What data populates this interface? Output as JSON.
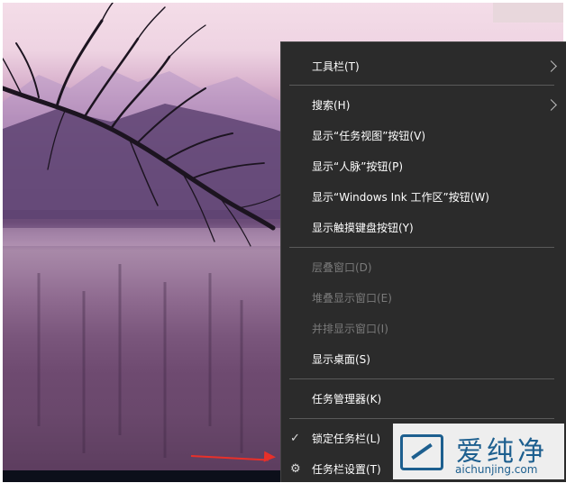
{
  "menu": {
    "items": [
      {
        "label": "工具栏(T)",
        "submenu": true,
        "enabled": true
      },
      {
        "label": "搜索(H)",
        "submenu": true,
        "enabled": true
      },
      {
        "label": "显示“任务视图”按钮(V)",
        "enabled": true
      },
      {
        "label": "显示“人脉”按钮(P)",
        "enabled": true
      },
      {
        "label": "显示“Windows Ink 工作区”按钮(W)",
        "enabled": true
      },
      {
        "label": "显示触摸键盘按钮(Y)",
        "enabled": true
      },
      {
        "label": "层叠窗口(D)",
        "enabled": false
      },
      {
        "label": "堆叠显示窗口(E)",
        "enabled": false
      },
      {
        "label": "并排显示窗口(I)",
        "enabled": false
      },
      {
        "label": "显示桌面(S)",
        "enabled": true
      },
      {
        "label": "任务管理器(K)",
        "enabled": true
      },
      {
        "label": "锁定任务栏(L)",
        "enabled": true,
        "checked": true
      },
      {
        "label": "任务栏设置(T)",
        "enabled": true,
        "icon": "gear-icon"
      }
    ]
  },
  "watermark": {
    "title": "爱纯净",
    "url": "aichunjing.com"
  },
  "colors": {
    "menu_bg": "#2b2b2b",
    "arrow": "#e8302a",
    "watermark": "#1d5f8f"
  }
}
